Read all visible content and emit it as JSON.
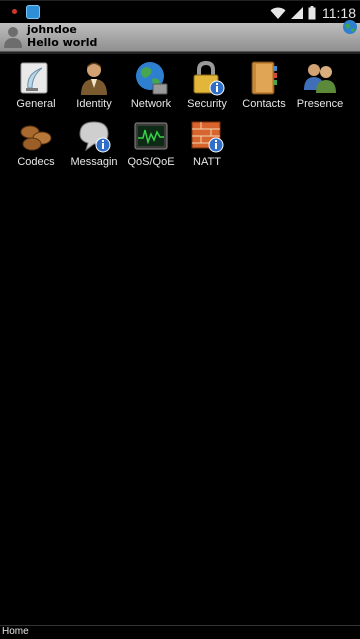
{
  "status_bar": {
    "time": "11:18"
  },
  "identity": {
    "user_name": "johndoe",
    "status_message": "Hello world"
  },
  "grid": {
    "items": [
      {
        "label": "General",
        "icon": "general-icon"
      },
      {
        "label": "Identity",
        "icon": "identity-icon"
      },
      {
        "label": "Network",
        "icon": "network-icon"
      },
      {
        "label": "Security",
        "icon": "security-icon"
      },
      {
        "label": "Contacts",
        "icon": "contacts-icon"
      },
      {
        "label": "Presence",
        "icon": "presence-icon"
      },
      {
        "label": "Codecs",
        "icon": "codecs-icon"
      },
      {
        "label": "Messagin",
        "icon": "messaging-icon"
      },
      {
        "label": "QoS/QoE",
        "icon": "qos-icon"
      },
      {
        "label": "NATT",
        "icon": "natt-icon"
      }
    ]
  },
  "bottom_bar": {
    "label": "Home"
  }
}
